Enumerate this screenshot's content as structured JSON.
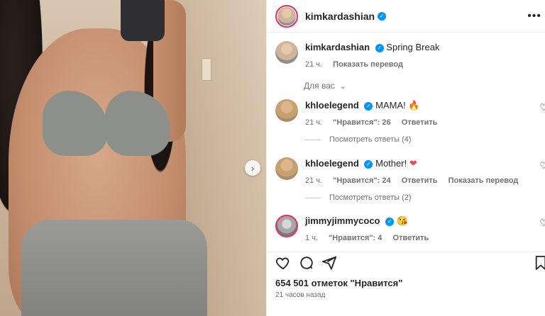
{
  "post": {
    "username": "kimkardashian",
    "caption_user": "kimkardashian",
    "caption_text": "Spring Break",
    "caption_time": "21 ч.",
    "caption_translate": "Показать перевод",
    "for_you_label": "Для вас",
    "likes": "654 501 отметок \"Нравится\"",
    "posted": "21 часов назад"
  },
  "comments": [
    {
      "user": "khloelegend",
      "text": "MAMA!",
      "emoji": "🔥",
      "time": "21 ч.",
      "likes": "\"Нравится\": 26",
      "reply": "Ответить",
      "translate": "",
      "replies": "Посмотреть ответы (4)"
    },
    {
      "user": "khloelegend",
      "text": "Mother!",
      "emoji": "❤",
      "time": "21 ч.",
      "likes": "\"Нравится\": 24",
      "reply": "Ответить",
      "translate": "Показать перевод",
      "replies": "Посмотреть ответы (2)"
    },
    {
      "user": "jimmyjimmycoco",
      "text": "",
      "emoji": "😘",
      "time": "1 ч.",
      "likes": "\"Нравится\": 4",
      "reply": "Ответить",
      "translate": "",
      "replies": ""
    }
  ],
  "icons": {
    "more": "more-horizontal-icon",
    "verified": "verified-badge-icon",
    "carousel_next": "chevron-right-icon",
    "like": "heart-icon",
    "comment": "comment-icon",
    "share": "share-icon",
    "save": "bookmark-icon"
  },
  "colors": {
    "verified": "#0095f6",
    "story_ring": "#e1306c",
    "muted": "#737373"
  }
}
